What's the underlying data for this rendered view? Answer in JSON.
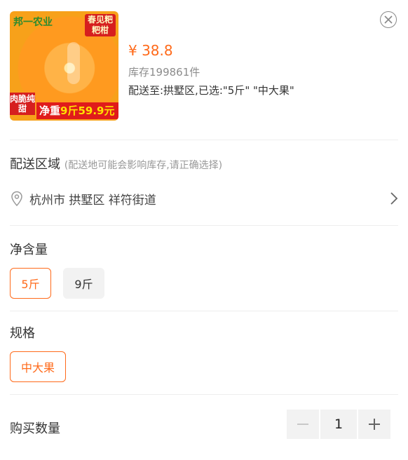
{
  "product": {
    "image_logo": "邦一农业",
    "image_tag_top": "春见粑粑柑",
    "image_tag_left": "肉脆纯甜",
    "image_tag_bottom_prefix": "净重",
    "image_tag_bottom_weight": "9斤",
    "image_tag_bottom_price": "59.9元",
    "price": "¥ 38.8",
    "stock": "库存199861件",
    "selected": "配送至:拱墅区,已选:\"5斤\" \"中大果\""
  },
  "delivery": {
    "title": "配送区域",
    "hint": "(配送地可能会影响库存,请正确选择)",
    "address": "杭州市 拱墅区 祥符街道"
  },
  "net_content": {
    "title": "净含量",
    "options": [
      {
        "label": "5斤",
        "selected": true
      },
      {
        "label": "9斤",
        "selected": false
      }
    ]
  },
  "spec": {
    "title": "规格",
    "options": [
      {
        "label": "中大果",
        "selected": true
      }
    ]
  },
  "quantity": {
    "label": "购买数量",
    "value": "1"
  },
  "colors": {
    "accent": "#ff6a1a",
    "muted": "#999999"
  },
  "icons": [
    "close-icon",
    "location-pin-icon",
    "chevron-right-icon",
    "minus-icon",
    "plus-icon"
  ]
}
